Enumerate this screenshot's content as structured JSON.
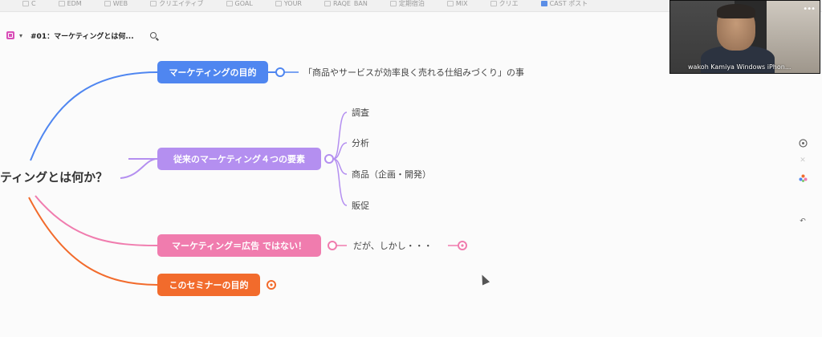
{
  "bookmarks": [
    "C",
    "",
    "EDM",
    "WEB",
    "クリエイティブ",
    "GOAL",
    "YOUR",
    "RAQE_BAN",
    "定期宿泊",
    "MIX",
    "クリエ",
    "CAST ポスト"
  ],
  "doc": {
    "title": "#01：マーケティングとは何..."
  },
  "video": {
    "participant_name": "wakoh Kamiya  Windows iPhon..."
  },
  "mindmap": {
    "root": "ティングとは何か？",
    "branches": [
      {
        "label": "マーケティングの目的",
        "color": "#4f86f0",
        "child": "「商品やサービスが効率良く売れる仕組みづくり」の事"
      },
      {
        "label": "従来のマーケティング４つの要素",
        "color": "#b48ff0",
        "children": [
          "調査",
          "分析",
          "商品（企画・開発）",
          "販促"
        ]
      },
      {
        "label": "マーケティング＝広告 ではない！",
        "color": "#f07cae",
        "child": "だが、しかし・・・"
      },
      {
        "label": "このセミナーの目的",
        "color": "#f26b2c"
      }
    ]
  },
  "colors": {
    "blue": "#4f86f0",
    "purple": "#b48ff0",
    "pink": "#f07cae",
    "orange": "#f26b2c"
  }
}
